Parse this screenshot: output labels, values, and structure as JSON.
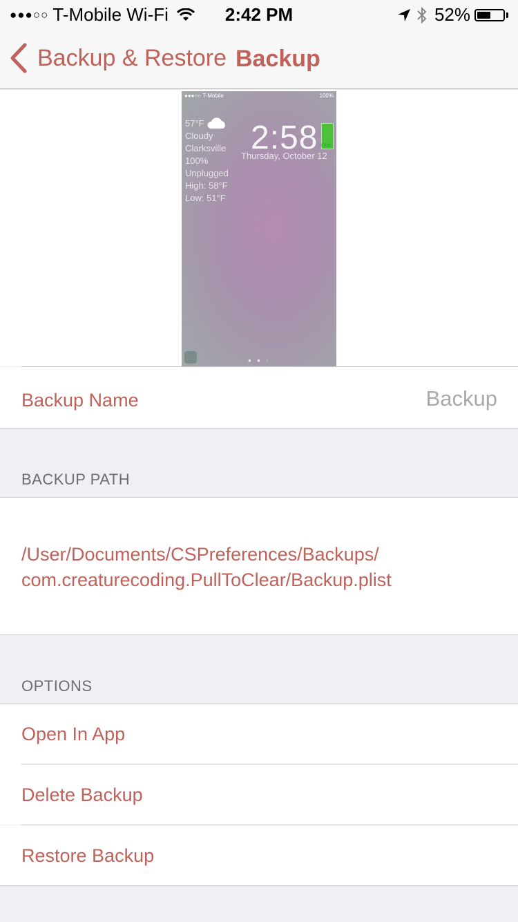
{
  "status_bar": {
    "signal": "●●●○○",
    "carrier": "T-Mobile Wi-Fi",
    "time": "2:42 PM",
    "battery_pct": "52%",
    "battery_level": 0.52
  },
  "nav": {
    "back_label": "Backup & Restore",
    "title": "Backup"
  },
  "preview": {
    "status_left": "●●●○○ T-Mobile",
    "status_right": "100%",
    "temp": "57°F",
    "condition": "Cloudy",
    "city": "Clarksville",
    "battery": "100%",
    "power": "Unplugged",
    "high": "High: 58°F",
    "low": "Low: 51°F",
    "time": "2:58",
    "date": "Thursday, October 12",
    "battery_widget": "100%",
    "pager": "● ● ◦"
  },
  "backup_name": {
    "label": "Backup Name",
    "value": "Backup"
  },
  "backup_path": {
    "header": "BACKUP PATH",
    "line1": "/User/Documents/CSPreferences/Backups/",
    "line2": "com.creaturecoding.PullToClear/Backup.plist"
  },
  "options": {
    "header": "OPTIONS",
    "items": [
      {
        "label": "Open In App"
      },
      {
        "label": "Delete Backup"
      },
      {
        "label": "Restore Backup"
      }
    ]
  },
  "colors": {
    "accent": "#c0615a",
    "background": "#efeff4"
  }
}
